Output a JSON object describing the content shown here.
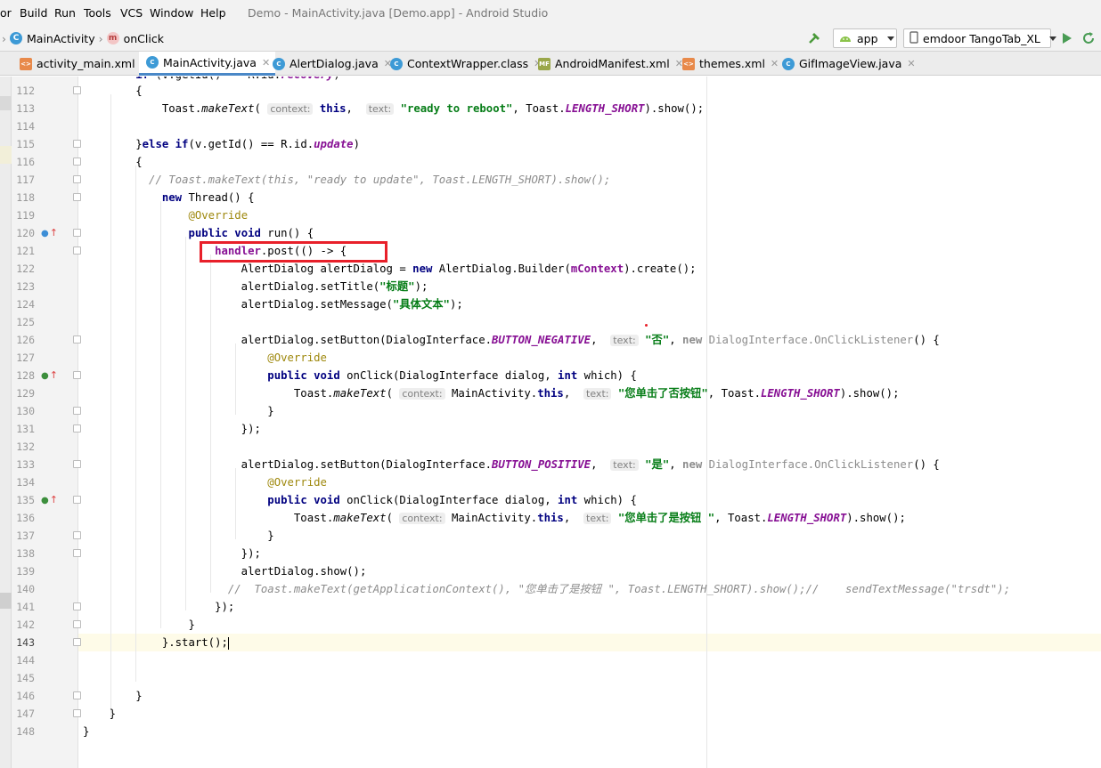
{
  "menu": {
    "items": [
      "or",
      "Build",
      "Run",
      "Tools",
      "VCS",
      "Window",
      "Help"
    ],
    "title": "Demo - MainActivity.java [Demo.app] - Android Studio"
  },
  "nav": {
    "breadcrumb": [
      "MainActivity",
      "onClick"
    ],
    "module": "app",
    "device": "emdoor TangoTab_XL"
  },
  "tabs": [
    {
      "label": "activity_main.xml",
      "icon": "xml-file-icon"
    },
    {
      "label": "MainActivity.java",
      "icon": "class-icon",
      "active": true
    },
    {
      "label": "AlertDialog.java",
      "icon": "class-icon"
    },
    {
      "label": "ContextWrapper.class",
      "icon": "class-icon"
    },
    {
      "label": "AndroidManifest.xml",
      "icon": "manifest-icon"
    },
    {
      "label": "themes.xml",
      "icon": "xml-file-icon"
    },
    {
      "label": "GifImageView.java",
      "icon": "class-icon"
    }
  ],
  "editor": {
    "line_numbers": [
      "112",
      "113",
      "114",
      "115",
      "116",
      "117",
      "118",
      "119",
      "120",
      "121",
      "122",
      "123",
      "124",
      "125",
      "126",
      "127",
      "128",
      "129",
      "130",
      "131",
      "132",
      "133",
      "134",
      "135",
      "136",
      "137",
      "138",
      "139",
      "140",
      "141",
      "142",
      "143",
      "144",
      "145",
      "146",
      "147",
      "148"
    ],
    "current_line": "143",
    "hints": {
      "context": "context:",
      "text": "text:"
    },
    "strings": {
      "ready_reboot": "\"ready to reboot\"",
      "title": "\"标题\"",
      "message": "\"具体文本\"",
      "no": "\"否\"",
      "yes": "\"是\"",
      "clicked_no": "\"您单击了否按钮\"",
      "clicked_yes": "\"您单击了是按钮 \"",
      "comment_117": "// Toast.makeText(this, \"ready to update\", Toast.LENGTH_SHORT).show();",
      "comment_140": "//  Toast.makeText(getApplicationContext(), \"您单击了是按钮 \", Toast.LENGTH_SHORT).show();//    sendTextMessage(\"trsdt\");"
    }
  },
  "colors": {
    "keyword": "#000080",
    "string": "#067d17",
    "annotation": "#9e880d",
    "field": "#871094",
    "highlight_box": "#e8202a",
    "active_tab_underline": "#4a88c7"
  }
}
